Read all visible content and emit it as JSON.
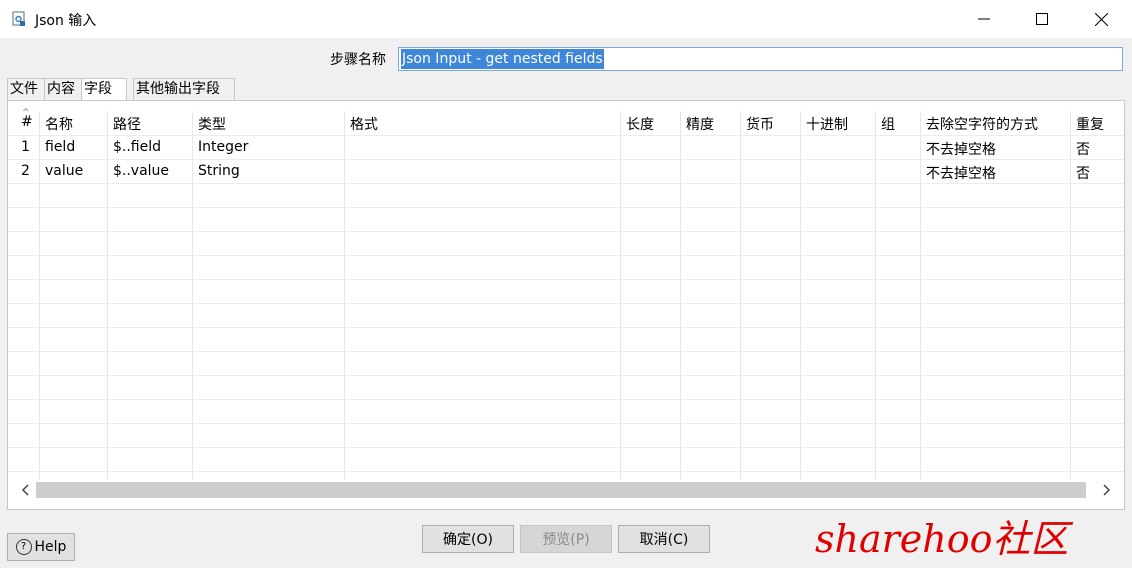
{
  "window": {
    "title": "Json 输入"
  },
  "step": {
    "label": "步骤名称",
    "value": "Json Input - get nested fields"
  },
  "tabs": [
    "文件",
    "内容",
    "字段",
    "其他输出字段"
  ],
  "table": {
    "sort_indicator": "^",
    "columns": [
      "#",
      "名称",
      "路径",
      "类型",
      "格式",
      "长度",
      "精度",
      "货币",
      "十进制",
      "组",
      "去除空字符的方式",
      "重复"
    ],
    "rows": [
      [
        "1",
        "field",
        "$..field",
        "Integer",
        "",
        "",
        "",
        "",
        "",
        "",
        "不去掉空格",
        "否"
      ],
      [
        "2",
        "value",
        "$..value",
        "String",
        "",
        "",
        "",
        "",
        "",
        "",
        "不去掉空格",
        "否"
      ]
    ]
  },
  "buttons": {
    "help": "Help",
    "ok": "确定(O)",
    "preview": "预览(P)",
    "cancel": "取消(C)"
  },
  "watermark": "sharehoo社区"
}
